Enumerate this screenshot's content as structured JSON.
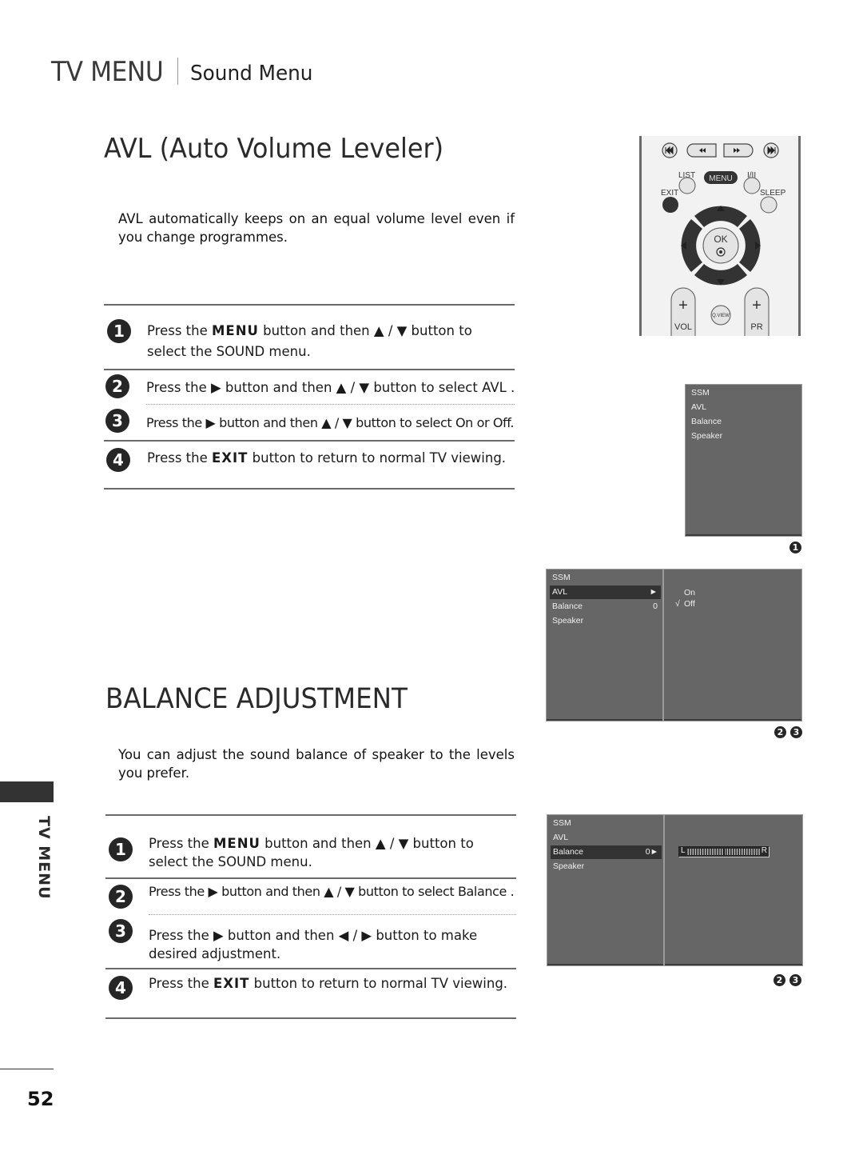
{
  "header": {
    "section": "TV MENU",
    "subsection": "Sound Menu"
  },
  "avl": {
    "title": "AVL (Auto Volume Leveler)",
    "intro": "AVL automatically keeps on an equal volume level even if you change programmes.",
    "steps": [
      {
        "num": "1",
        "pre": "Press the ",
        "key": "MENU",
        "post": " button and then ▲ / ▼ button to select the SOUND menu."
      },
      {
        "num": "2",
        "pre": "Press the ▶ button and then ▲ / ▼ button to select ",
        "key": "AVL",
        "post": " ."
      },
      {
        "num": "3",
        "pre": "Press the ▶ button and then ▲ / ▼ button to select ",
        "key": "On",
        "mid": " or ",
        "key2": "Off",
        "post": "."
      },
      {
        "num": "4",
        "pre": "Press the ",
        "key": "EXIT",
        "post": " button to return to normal TV viewing."
      }
    ]
  },
  "balance": {
    "title": "BALANCE ADJUSTMENT",
    "intro": "You can adjust the sound balance of speaker to the levels you prefer.",
    "steps": [
      {
        "num": "1",
        "pre": "Press the ",
        "key": "MENU",
        "post": " button and then ▲ / ▼ button to select the SOUND menu."
      },
      {
        "num": "2",
        "pre": "Press the ▶ button and then ▲ / ▼ button to select ",
        "key": "Balance",
        "post": " ."
      },
      {
        "num": "3",
        "pre": "Press the  ▶ button and then ◀ / ▶ button to make desired adjustment."
      },
      {
        "num": "4",
        "pre": "Press the ",
        "key": "EXIT",
        "post": " button to return to normal TV viewing."
      }
    ]
  },
  "remote": {
    "labels": {
      "list": "LIST",
      "menu": "MENU",
      "i_ii": "I/II",
      "exit": "EXIT",
      "sleep": "SLEEP",
      "ok": "OK",
      "qview": "Q.VIEW",
      "vol": "VOL",
      "pr": "PR",
      "plus": "+"
    },
    "icons": [
      "skip-back-icon",
      "rewind-icon",
      "fast-forward-icon",
      "skip-forward-icon",
      "arrow-up-icon",
      "arrow-down-icon",
      "arrow-left-icon",
      "arrow-right-icon"
    ]
  },
  "osd1": {
    "items": [
      "SSM",
      "AVL",
      "Balance",
      "Speaker"
    ],
    "step_badge": "1"
  },
  "osd2": {
    "items": [
      {
        "label": "SSM",
        "value": ""
      },
      {
        "label": "AVL",
        "value": "►",
        "selected": true
      },
      {
        "label": "Balance",
        "value": "0"
      },
      {
        "label": "Speaker",
        "value": ""
      }
    ],
    "options": [
      {
        "check": "",
        "label": "On"
      },
      {
        "check": "√",
        "label": "Off"
      }
    ],
    "step_badges": [
      "2",
      "3"
    ]
  },
  "osd3": {
    "items": [
      {
        "label": "SSM",
        "value": ""
      },
      {
        "label": "AVL",
        "value": ""
      },
      {
        "label": "Balance",
        "value": "0►",
        "selected": true
      },
      {
        "label": "Speaker",
        "value": ""
      }
    ],
    "balance_bar": {
      "left_label": "L",
      "right_label": "R",
      "value": 0,
      "min": -50,
      "max": 50
    },
    "step_badges": [
      "2",
      "3"
    ]
  },
  "sidebar": {
    "label": "TV MENU"
  },
  "page_number": "52"
}
